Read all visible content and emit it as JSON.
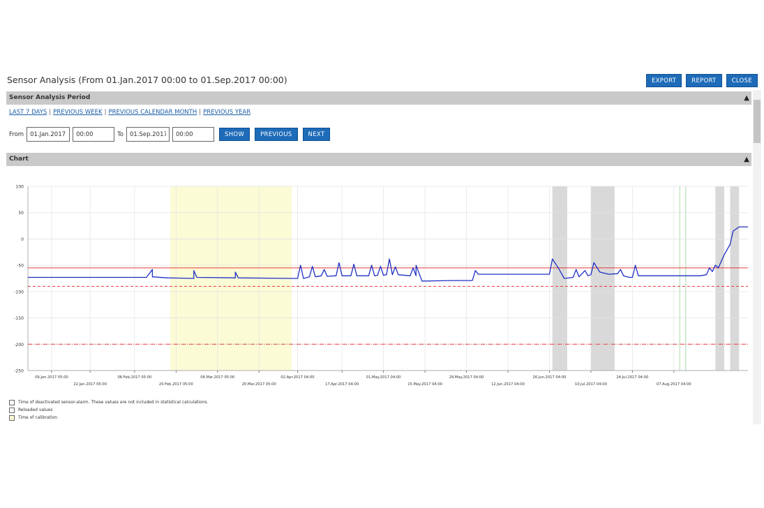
{
  "page": {
    "title": "Sensor Analysis (From 01.Jan.2017 00:00 to 01.Sep.2017 00:00)"
  },
  "toolbar": {
    "export_label": "EXPORT",
    "report_label": "REPORT",
    "close_label": "CLOSE"
  },
  "period_section": {
    "header": "Sensor Analysis Period",
    "links": [
      "LAST 7 DAYS",
      "PREVIOUS WEEK",
      "PREVIOUS CALENDAR MONTH",
      "PREVIOUS YEAR"
    ],
    "separator": "|",
    "from_label": "From",
    "from_date": "01.Jan.2017",
    "from_time": "00:00",
    "to_label": "To",
    "to_date": "01.Sep.2017",
    "to_time": "00:00",
    "show_label": "SHOW",
    "previous_label": "PREVIOUS",
    "next_label": "NEXT"
  },
  "chart_section": {
    "header": "Chart"
  },
  "colors": {
    "button": "#1e6bb8",
    "header_bar": "#c9c9c9",
    "series_line": "#1f2fc4",
    "threshold_red": "#e53935",
    "calibration_band": "#fbfbd6",
    "deactivated_band": "#d9d9d9",
    "reloaded_marker": "#b9e0b9"
  },
  "chart_data": {
    "type": "line",
    "ylim": [
      -250,
      100
    ],
    "yticks": [
      100,
      50,
      0,
      -50,
      -100,
      -150,
      -200,
      -250
    ],
    "xlim": [
      "2017-01-01",
      "2017-09-01"
    ],
    "grid": true,
    "xtick_labels_upper": [
      {
        "date": "2017-01-09",
        "label": "09.Jan.2017 05:00"
      },
      {
        "date": "2017-02-06",
        "label": "06.Feb.2017 05:00"
      },
      {
        "date": "2017-03-06",
        "label": "06.Mar.2017 05:00"
      },
      {
        "date": "2017-04-02",
        "label": "02.Apr.2017 04:00"
      },
      {
        "date": "2017-05-01",
        "label": "01.May.2017 04:00"
      },
      {
        "date": "2017-05-29",
        "label": "29.May.2017 04:00"
      },
      {
        "date": "2017-06-26",
        "label": "26.Jun.2017 04:00"
      },
      {
        "date": "2017-07-24",
        "label": "24.Jul.2017 04:00"
      }
    ],
    "xtick_labels_lower": [
      {
        "date": "2017-01-22",
        "label": "22.Jan.2017 05:00"
      },
      {
        "date": "2017-02-20",
        "label": "20.Feb.2017 05:00"
      },
      {
        "date": "2017-03-20",
        "label": "20.Mar.2017 05:00"
      },
      {
        "date": "2017-04-17",
        "label": "17.Apr.2017 04:00"
      },
      {
        "date": "2017-05-15",
        "label": "15.May.2017 04:00"
      },
      {
        "date": "2017-06-12",
        "label": "12.Jun.2017 04:00"
      },
      {
        "date": "2017-07-10",
        "label": "10.Jul.2017 04:00"
      },
      {
        "date": "2017-08-07",
        "label": "07.Aug.2017 04:00"
      }
    ],
    "thresholds": [
      {
        "value": -55,
        "style": "solid"
      },
      {
        "value": -90,
        "style": "dashed"
      },
      {
        "value": -200,
        "style": "dashdot"
      }
    ],
    "calibration_bands": [
      {
        "start": "2017-02-18",
        "end": "2017-03-31"
      }
    ],
    "deactivated_bands": [
      {
        "start": "2017-06-27",
        "end": "2017-07-02"
      },
      {
        "start": "2017-07-10",
        "end": "2017-07-18"
      },
      {
        "start": "2017-08-21",
        "end": "2017-08-24"
      },
      {
        "start": "2017-08-26",
        "end": "2017-08-29"
      }
    ],
    "reloaded_markers": [
      {
        "date": "2017-08-09"
      },
      {
        "date": "2017-08-11"
      }
    ],
    "series": [
      {
        "points": [
          [
            "2017-01-01",
            -73
          ],
          [
            "2017-02-10",
            -73
          ],
          [
            "2017-02-12",
            -58
          ],
          [
            "2017-02-12",
            -72
          ],
          [
            "2017-02-17",
            -74
          ],
          [
            "2017-02-26",
            -75
          ],
          [
            "2017-02-26",
            -60
          ],
          [
            "2017-02-27",
            -73
          ],
          [
            "2017-03-12",
            -74
          ],
          [
            "2017-03-12",
            -63
          ],
          [
            "2017-03-13",
            -74
          ],
          [
            "2017-03-31",
            -75
          ],
          [
            "2017-04-02",
            -75
          ],
          [
            "2017-04-03",
            -50
          ],
          [
            "2017-04-04",
            -75
          ],
          [
            "2017-04-06",
            -72
          ],
          [
            "2017-04-07",
            -52
          ],
          [
            "2017-04-08",
            -72
          ],
          [
            "2017-04-10",
            -70
          ],
          [
            "2017-04-11",
            -58
          ],
          [
            "2017-04-12",
            -71
          ],
          [
            "2017-04-15",
            -70
          ],
          [
            "2017-04-16",
            -45
          ],
          [
            "2017-04-17",
            -70
          ],
          [
            "2017-04-20",
            -70
          ],
          [
            "2017-04-21",
            -48
          ],
          [
            "2017-04-22",
            -70
          ],
          [
            "2017-04-26",
            -70
          ],
          [
            "2017-04-27",
            -50
          ],
          [
            "2017-04-28",
            -70
          ],
          [
            "2017-04-29",
            -69
          ],
          [
            "2017-04-30",
            -52
          ],
          [
            "2017-05-01",
            -69
          ],
          [
            "2017-05-02",
            -68
          ],
          [
            "2017-05-03",
            -38
          ],
          [
            "2017-05-04",
            -68
          ],
          [
            "2017-05-05",
            -53
          ],
          [
            "2017-05-06",
            -68
          ],
          [
            "2017-05-10",
            -70
          ],
          [
            "2017-05-11",
            -55
          ],
          [
            "2017-05-12",
            -70
          ],
          [
            "2017-05-12",
            -50
          ],
          [
            "2017-05-14",
            -80
          ],
          [
            "2017-05-25",
            -79
          ],
          [
            "2017-05-31",
            -79
          ],
          [
            "2017-06-01",
            -60
          ],
          [
            "2017-06-02",
            -67
          ],
          [
            "2017-06-26",
            -67
          ],
          [
            "2017-06-27",
            -38
          ],
          [
            "2017-06-29",
            -55
          ],
          [
            "2017-07-01",
            -75
          ],
          [
            "2017-07-04",
            -73
          ],
          [
            "2017-07-05",
            -58
          ],
          [
            "2017-07-06",
            -72
          ],
          [
            "2017-07-08",
            -60
          ],
          [
            "2017-07-09",
            -70
          ],
          [
            "2017-07-10",
            -68
          ],
          [
            "2017-07-11",
            -45
          ],
          [
            "2017-07-13",
            -63
          ],
          [
            "2017-07-16",
            -67
          ],
          [
            "2017-07-19",
            -66
          ],
          [
            "2017-07-20",
            -58
          ],
          [
            "2017-07-21",
            -70
          ],
          [
            "2017-07-23",
            -73
          ],
          [
            "2017-07-24",
            -73
          ],
          [
            "2017-07-25",
            -50
          ],
          [
            "2017-07-26",
            -70
          ],
          [
            "2017-08-08",
            -70
          ],
          [
            "2017-08-16",
            -70
          ],
          [
            "2017-08-18",
            -68
          ],
          [
            "2017-08-19",
            -55
          ],
          [
            "2017-08-20",
            -62
          ],
          [
            "2017-08-21",
            -50
          ],
          [
            "2017-08-22",
            -55
          ],
          [
            "2017-08-24",
            -30
          ],
          [
            "2017-08-26",
            -10
          ],
          [
            "2017-08-27",
            15
          ],
          [
            "2017-08-29",
            23
          ],
          [
            "2017-09-01",
            23
          ]
        ]
      }
    ]
  },
  "legend": {
    "items": [
      "Time of deactivated sensor-alarm. These values are not included in statistical calculations.",
      "Reloaded values",
      "Time of calibration"
    ]
  }
}
